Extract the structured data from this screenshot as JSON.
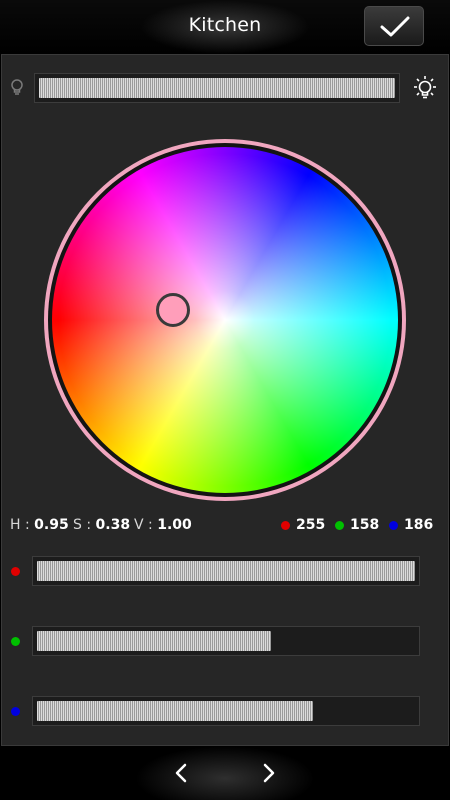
{
  "header": {
    "title": "Kitchen",
    "confirm_icon": "checkmark-icon"
  },
  "brightness": {
    "level": 1.0,
    "min_icon": "bulb-off-icon",
    "max_icon": "bulb-on-icon"
  },
  "color_wheel": {
    "selected_color": "#ff9eba"
  },
  "hsv": {
    "h_label": "H",
    "h_value": "0.95",
    "s_label": "S",
    "s_value": "0.38",
    "v_label": "V",
    "v_value": "1.00"
  },
  "rgb": {
    "r_value": "255",
    "g_value": "158",
    "b_value": "186",
    "r_color": "#e00000",
    "g_color": "#00c000",
    "b_color": "#0000e0"
  },
  "sliders": {
    "red_level": 1.0,
    "green_level": 0.62,
    "blue_level": 0.73
  },
  "footer": {
    "prev_icon": "chevron-left-icon",
    "next_icon": "chevron-right-icon"
  }
}
